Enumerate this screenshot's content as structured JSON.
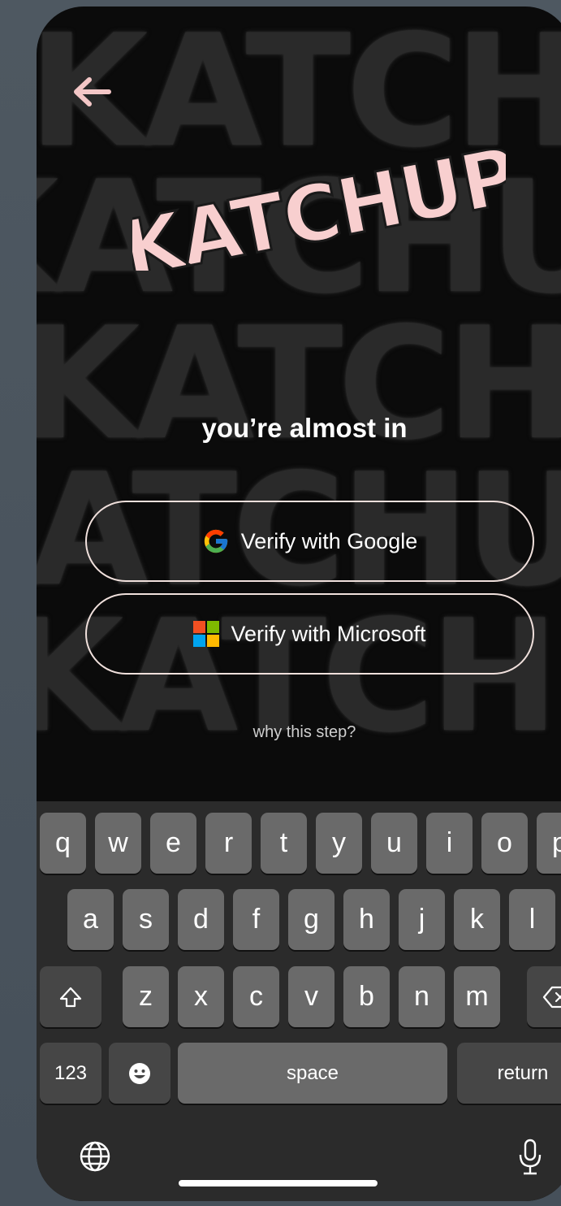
{
  "app": {
    "logo_text": "KATCHUP",
    "back_label": "←"
  },
  "main": {
    "headline": "you’re almost in",
    "google_button": "Verify with Google",
    "microsoft_button": "Verify with Microsoft",
    "why_link": "why this step?"
  },
  "keyboard": {
    "row1": [
      "q",
      "w",
      "e",
      "r",
      "t",
      "y",
      "u",
      "i",
      "o",
      "p"
    ],
    "row2": [
      "a",
      "s",
      "d",
      "f",
      "g",
      "h",
      "j",
      "k",
      "l"
    ],
    "row3": [
      "z",
      "x",
      "c",
      "v",
      "b",
      "n",
      "m"
    ],
    "numbers_key": "123",
    "space_key": "space",
    "return_key": "return"
  },
  "icons": {
    "back": "arrow-left-icon",
    "google": "google-logo-icon",
    "microsoft": "microsoft-logo-icon",
    "shift": "shift-icon",
    "delete": "backspace-icon",
    "emoji": "emoji-icon",
    "globe": "globe-icon",
    "mic": "microphone-icon"
  },
  "colors": {
    "logo_pink": "#f8cfcf",
    "back_arrow": "#f4c7c7",
    "button_border": "#f0e0dc",
    "background": "#0b0b0b",
    "keyboard_bg": "#2b2b2b",
    "key_bg": "#6a6a6a"
  }
}
